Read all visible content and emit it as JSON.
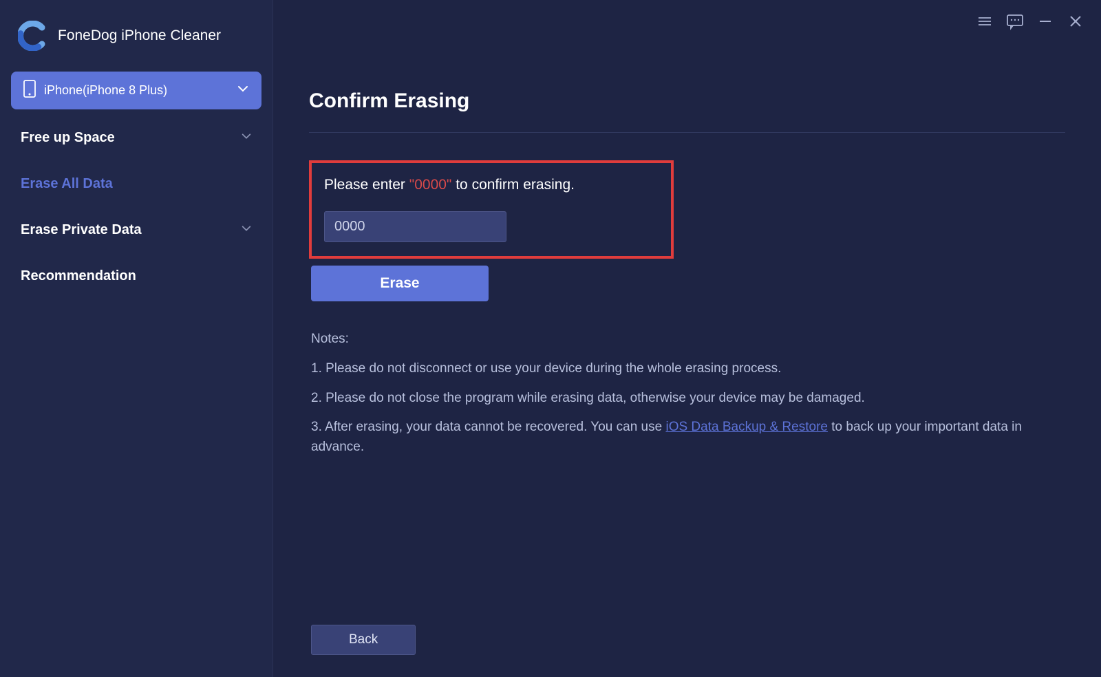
{
  "app": {
    "title": "FoneDog iPhone Cleaner"
  },
  "device": {
    "name": "iPhone(iPhone 8 Plus)"
  },
  "sidebar": {
    "items": [
      {
        "label": "Free up Space",
        "expandable": true,
        "active": false
      },
      {
        "label": "Erase All Data",
        "expandable": false,
        "active": true
      },
      {
        "label": "Erase Private Data",
        "expandable": true,
        "active": false
      },
      {
        "label": "Recommendation",
        "expandable": false,
        "active": false
      }
    ]
  },
  "main": {
    "title": "Confirm Erasing",
    "confirm_prefix": "Please enter ",
    "confirm_code": "\"0000\"",
    "confirm_suffix": " to confirm erasing.",
    "input_value": "0000",
    "erase_button": "Erase",
    "back_button": "Back",
    "notes_title": "Notes:",
    "note1": "1. Please do not disconnect or use your device during the whole erasing process.",
    "note2": "2. Please do not close the program while erasing data, otherwise your device may be damaged.",
    "note3_prefix": "3. After erasing, your data cannot be recovered. You can use ",
    "note3_link": "iOS Data Backup & Restore",
    "note3_suffix": " to back up your important data in advance."
  }
}
